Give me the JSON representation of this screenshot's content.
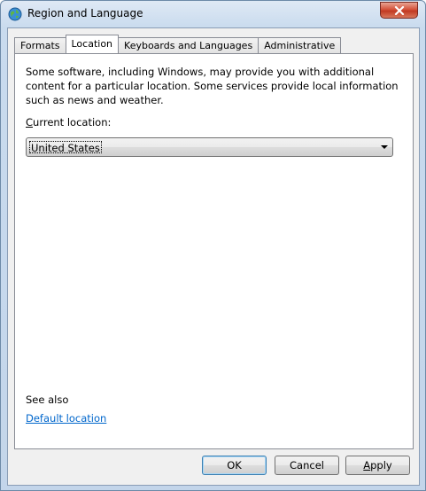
{
  "window": {
    "title": "Region and Language"
  },
  "tabs": [
    {
      "label": "Formats"
    },
    {
      "label": "Location"
    },
    {
      "label": "Keyboards and Languages"
    },
    {
      "label": "Administrative"
    }
  ],
  "location_tab": {
    "description": "Some software, including Windows, may provide you with additional content for a particular location. Some services provide local information such as news and weather.",
    "current_location_label_access": "C",
    "current_location_label_rest": "urrent location:",
    "current_location_value": "United States",
    "see_also": "See also",
    "default_location_link": "Default location"
  },
  "buttons": {
    "ok": "OK",
    "cancel": "Cancel",
    "apply_access": "A",
    "apply_rest": "pply"
  },
  "colors": {
    "link": "#0066cc",
    "close_button": "#c13a22"
  }
}
